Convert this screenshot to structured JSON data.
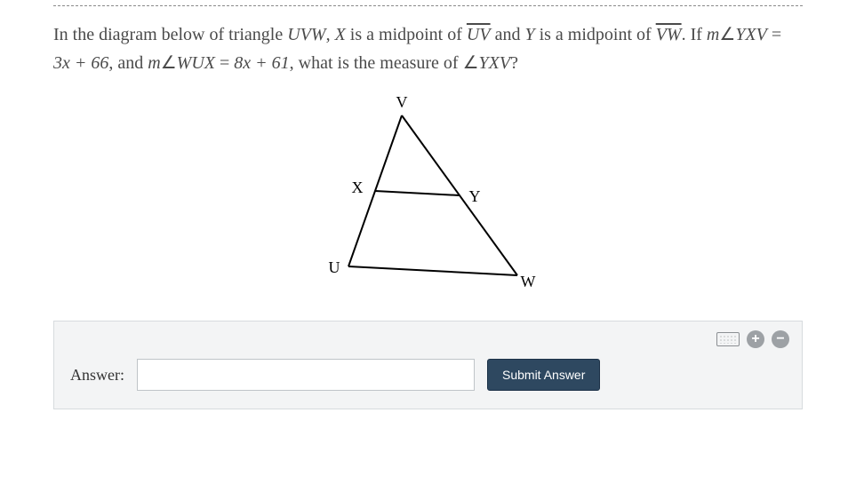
{
  "problem": {
    "triangle_name": "UVW",
    "midpoint_X": "X",
    "midpoint_X_of": "UV",
    "midpoint_Y": "Y",
    "midpoint_Y_of": "VW",
    "angle1_name": "YXV",
    "angle1_expr": "3x + 66",
    "angle2_name": "WUX",
    "angle2_expr": "8x + 61",
    "question_angle": "YXV",
    "sentence_prefix": "In the diagram below of triangle ",
    "sentence_mid1": ", ",
    "sentence_mid2": " is a midpoint of ",
    "sentence_mid3": " and ",
    "sentence_mid4": " is a midpoint of ",
    "sentence_if": ". If ",
    "sentence_measure_prefix": "m",
    "sentence_eq": " = ",
    "sentence_and": ", and ",
    "sentence_whatis": ", what is the measure of ",
    "sentence_q": "?"
  },
  "diagram": {
    "labels": {
      "V": "V",
      "X": "X",
      "Y": "Y",
      "U": "U",
      "W": "W"
    }
  },
  "answer": {
    "label": "Answer:",
    "submit": "Submit Answer",
    "input_value": ""
  },
  "icons": {
    "plus": "+",
    "minus": "−"
  }
}
